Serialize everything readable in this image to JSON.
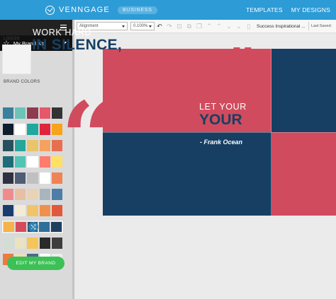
{
  "app": {
    "name": "VENNGAGE",
    "plan": "BUSINESS"
  },
  "nav": {
    "templates": "TEMPLATES",
    "my_designs": "MY DESIGNS"
  },
  "sidebar": {
    "brand_kit_label": "My Brand Kit",
    "logos_label": "LOGOS",
    "brand_colors_label": "BRAND COLORS",
    "edit_button": "EDIT MY BRAND",
    "palettes": [
      [
        "#3a7f9c",
        "#6cc4b6",
        "#8e3a4f",
        "#e6576a",
        "#333333"
      ],
      [
        "#0f1e2e",
        "#ffffff",
        "#1fa89d",
        "#e0243a",
        "#f7a31c"
      ],
      [
        "#27505f",
        "#26a69a",
        "#e9c46a",
        "#f4a261",
        "#e76f51"
      ],
      [
        "#1e6c79",
        "#51c4b5",
        "#ffffff",
        "#ff7b6a",
        "#ffe066"
      ],
      [
        "#2d3142",
        "#4f5d75",
        "#bfc0c0",
        "#ffffff",
        "#ef8354"
      ],
      [
        "#f08b8b",
        "#e8bfa2",
        "#e8d3b5",
        "#aab4bd",
        "#4d7ea8"
      ],
      [
        "#193e6e",
        "#f2ebd6",
        "#f1c46a",
        "#f0904d",
        "#e1593d"
      ],
      [
        "#f4b44a",
        "#d64b5b",
        "#2f4f6f",
        "#2f6f9a",
        "#1f3f5f"
      ],
      [
        "#d2ddd4",
        "#e9e3c1",
        "#f5c55a",
        "#2a2a2a",
        "#3d3d3d"
      ],
      [
        "#e97c3f",
        "#f2dcb3",
        "#4d6a80",
        "#ffffff",
        "#ececec"
      ]
    ]
  },
  "toolbar": {
    "alignment": "Alignment",
    "opacity": "0.100%",
    "doc_title": "Success Inspirational ...",
    "last_saved": "Last Saved:"
  },
  "poster": {
    "line1": "WORK HARD",
    "line2": "IN SILENCE,",
    "line3": "LET YOUR",
    "line4": "YOUR",
    "author": "- Frank Ocean",
    "quote_glyph": "“",
    "colors": {
      "red": "#d14b5e",
      "navy": "#163f63",
      "white": "#ffffff",
      "text_navy": "#163f63"
    }
  },
  "icons": {
    "logo": "venngage-logo-icon",
    "menu": "hamburger-icon",
    "star": "star-icon",
    "shuffle": "shuffle-icon",
    "undo": "undo-icon",
    "redo": "redo-icon"
  }
}
